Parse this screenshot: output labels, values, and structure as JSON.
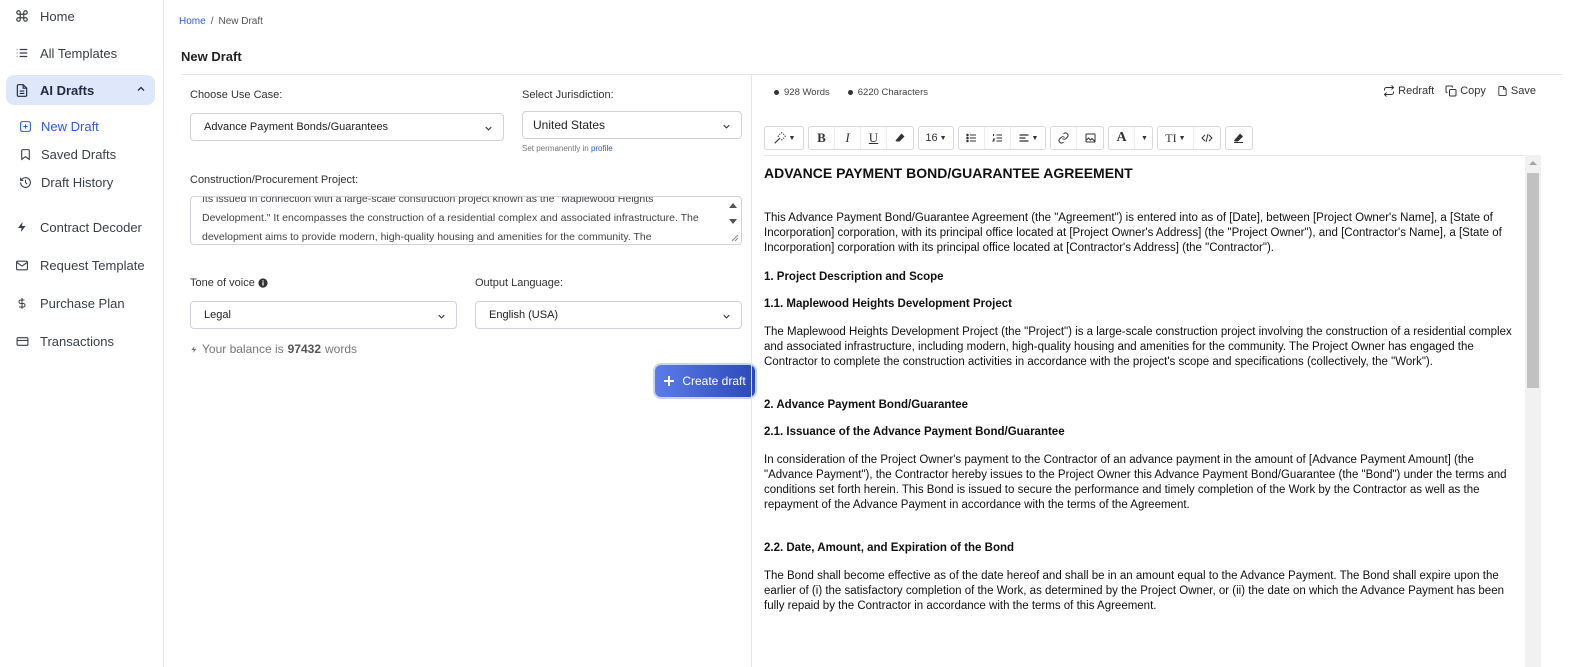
{
  "sidebar": {
    "items": [
      {
        "label": "Home",
        "icon": "command-icon"
      },
      {
        "label": "All Templates",
        "icon": "list-icon"
      },
      {
        "label": "AI Drafts",
        "icon": "document-icon"
      },
      {
        "label": "Contract Decoder",
        "icon": "bolt-icon"
      },
      {
        "label": "Request Template",
        "icon": "mail-icon"
      },
      {
        "label": "Purchase Plan",
        "icon": "dollar-icon"
      },
      {
        "label": "Transactions",
        "icon": "card-icon"
      }
    ],
    "sub_items": [
      {
        "label": "New Draft",
        "icon": "plus-square-icon"
      },
      {
        "label": "Saved Drafts",
        "icon": "bookmark-icon"
      },
      {
        "label": "Draft History",
        "icon": "history-icon"
      }
    ]
  },
  "breadcrumb": {
    "home": "Home",
    "separator": "/",
    "current": "New Draft"
  },
  "page_title": "New Draft",
  "form": {
    "use_case_label": "Choose Use Case:",
    "use_case_value": "Advance Payment Bonds/Guarantees",
    "jurisdiction_label": "Select Jurisdiction:",
    "jurisdiction_value": "United States",
    "jurisdiction_hint": "Set permanently in",
    "jurisdiction_hint_link": "profile",
    "project_label": "Construction/Procurement Project:",
    "project_text": "Its issued in connection with a large-scale construction project known as the \"Maplewood Heights Development.\" It encompasses the construction of a residential complex and associated infrastructure. The development aims to provide modern, high-quality housing and amenities for the community. The",
    "tone_label": "Tone of voice",
    "tone_value": "Legal",
    "language_label": "Output Language:",
    "language_value": "English (USA)",
    "balance_prefix": "Your balance is",
    "balance_value": "97432",
    "balance_suffix": "words",
    "create_label": "Create draft"
  },
  "editor": {
    "words": "928 Words",
    "characters": "6220 Characters",
    "redraft_label": "Redraft",
    "copy_label": "Copy",
    "save_label": "Save",
    "font_size": "16",
    "title": "ADVANCE PAYMENT BOND/GUARANTEE AGREEMENT",
    "p1": "This Advance Payment Bond/Guarantee Agreement (the \"Agreement\") is entered into as of [Date], between [Project Owner's Name], a [State of Incorporation] corporation, with its principal office located at [Project Owner's Address] (the \"Project Owner\"), and [Contractor's Name], a [State of Incorporation] corporation with its principal office located at [Contractor's Address] (the \"Contractor\").",
    "h1": "1. Project Description and Scope",
    "h1_1": "1.1. Maplewood Heights Development Project",
    "p2": "The Maplewood Heights Development Project (the \"Project\") is a large-scale construction project involving the construction of a residential complex and associated infrastructure, including modern, high-quality housing and amenities for the community. The Project Owner has engaged the Contractor to complete the construction activities in accordance with the project's scope and specifications (collectively, the \"Work\").",
    "h2": "2. Advance Payment Bond/Guarantee",
    "h2_1": "2.1. Issuance of the Advance Payment Bond/Guarantee",
    "p3": "In consideration of the Project Owner's payment to the Contractor of an advance payment in the amount of [Advance Payment Amount] (the \"Advance Payment\"), the Contractor hereby issues to the Project Owner this Advance Payment Bond/Guarantee (the \"Bond\") under the terms and conditions set forth herein. This Bond is issued to secure the performance and timely completion of the Work by the Contractor as well as the repayment of the Advance Payment in accordance with the terms of the Agreement.",
    "h2_2": "2.2. Date, Amount, and Expiration of the Bond",
    "p4": "The Bond shall become effective as of the date hereof and shall be in an amount equal to the Advance Payment. The Bond shall expire upon the earlier of (i) the satisfactory completion of the Work, as determined by the Project Owner, or (ii) the date on which the Advance Payment has been fully repaid by the Contractor in accordance with the terms of this Agreement."
  },
  "colors": {
    "accent": "#2f5bd6",
    "active_bg": "#dfe7fb",
    "button_from": "#5b7de8",
    "button_to": "#2c48b9"
  }
}
